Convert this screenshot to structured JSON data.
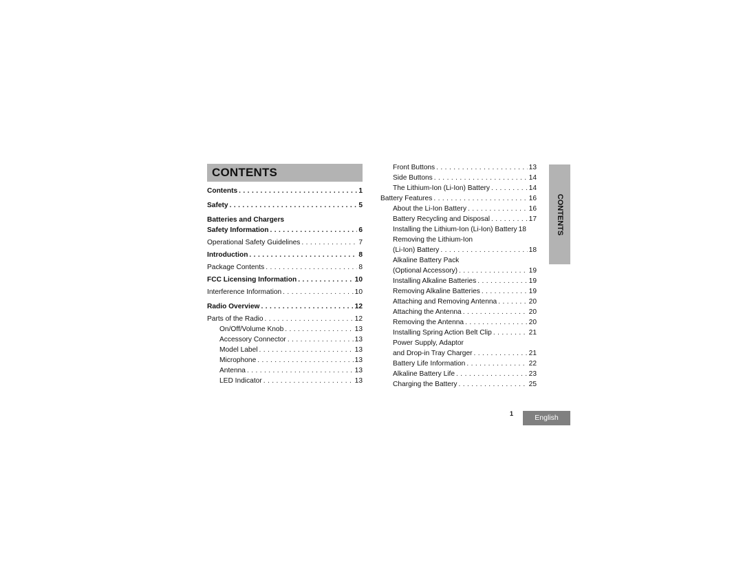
{
  "header": {
    "title": "CONTENTS"
  },
  "side_tab": {
    "label": "CONTENTS"
  },
  "footer": {
    "page_number": "1",
    "language": "English"
  },
  "toc_left": [
    {
      "title": "Contents",
      "page": "1",
      "bold": true,
      "level": 1,
      "gap_before": 0
    },
    {
      "title": "Safety",
      "page": "5",
      "bold": true,
      "level": 1,
      "gap_before": 6
    },
    {
      "title": "Batteries and Chargers",
      "page": "",
      "bold": true,
      "level": 1,
      "gap_before": 6,
      "nodots": true
    },
    {
      "title": "Safety Information",
      "page": "6",
      "bold": true,
      "level": 1,
      "gap_before": 0
    },
    {
      "title": "Operational Safety Guidelines",
      "page": "7",
      "bold": false,
      "level": 1,
      "gap_before": 3
    },
    {
      "title": "Introduction",
      "page": "8",
      "bold": true,
      "level": 1,
      "gap_before": 3
    },
    {
      "title": "Package Contents",
      "page": "8",
      "bold": false,
      "level": 1,
      "gap_before": 3
    },
    {
      "title": "FCC Licensing Information",
      "page": "10",
      "bold": true,
      "level": 1,
      "gap_before": 3
    },
    {
      "title": "Interference Information",
      "page": "10",
      "bold": false,
      "level": 1,
      "gap_before": 3
    },
    {
      "title": "Radio Overview",
      "page": "12",
      "bold": true,
      "level": 1,
      "gap_before": 6
    },
    {
      "title": "Parts of the Radio",
      "page": "12",
      "bold": false,
      "level": 1,
      "gap_before": 3
    },
    {
      "title": "On/Off/Volume Knob",
      "page": "13",
      "bold": false,
      "level": 2,
      "gap_before": 0
    },
    {
      "title": "Accessory Connector",
      "page": "13",
      "bold": false,
      "level": 2,
      "gap_before": 0
    },
    {
      "title": "Model Label",
      "page": "13",
      "bold": false,
      "level": 2,
      "gap_before": 0
    },
    {
      "title": "Microphone",
      "page": "13",
      "bold": false,
      "level": 2,
      "gap_before": 0
    },
    {
      "title": "Antenna",
      "page": "13",
      "bold": false,
      "level": 2,
      "gap_before": 0
    },
    {
      "title": "LED Indicator",
      "page": "13",
      "bold": false,
      "level": 2,
      "gap_before": 0
    }
  ],
  "toc_right": [
    {
      "title": "Front Buttons",
      "page": "13",
      "level": 2
    },
    {
      "title": "Side Buttons",
      "page": "14",
      "level": 2
    },
    {
      "title": "The Lithium-Ion (Li-Ion) Battery",
      "page": "14",
      "level": 2
    },
    {
      "title": "Battery Features",
      "page": "16",
      "level": 1
    },
    {
      "title": "About the Li-Ion Battery",
      "page": "16",
      "level": 2
    },
    {
      "title": "Battery Recycling and Disposal",
      "page": "17",
      "level": 2
    },
    {
      "title": "Installing the Lithium-Ion (Li-Ion) Battery",
      "page": "18",
      "level": 2,
      "nodots": true
    },
    {
      "title": "Removing the Lithium-Ion",
      "page": "",
      "level": 2,
      "nodots": true
    },
    {
      "title": "(Li-Ion) Battery",
      "page": "18",
      "level": 2
    },
    {
      "title": "Alkaline Battery Pack",
      "page": "",
      "level": 2,
      "nodots": true
    },
    {
      "title": "(Optional Accessory)",
      "page": "19",
      "level": 2
    },
    {
      "title": "Installing Alkaline Batteries",
      "page": "19",
      "level": 2
    },
    {
      "title": "Removing Alkaline Batteries",
      "page": "19",
      "level": 2
    },
    {
      "title": "Attaching and Removing Antenna",
      "page": "20",
      "level": 2
    },
    {
      "title": "Attaching the Antenna",
      "page": "20",
      "level": 2
    },
    {
      "title": "Removing the Antenna",
      "page": "20",
      "level": 2
    },
    {
      "title": "Installing Spring Action Belt Clip",
      "page": "21",
      "level": 2
    },
    {
      "title": "Power Supply, Adaptor",
      "page": "",
      "level": 2,
      "nodots": true
    },
    {
      "title": "and Drop-in Tray Charger",
      "page": "21",
      "level": 2
    },
    {
      "title": "Battery Life Information",
      "page": "22",
      "level": 2
    },
    {
      "title": "Alkaline Battery Life",
      "page": "23",
      "level": 2
    },
    {
      "title": "Charging the Battery",
      "page": "25",
      "level": 2
    }
  ]
}
